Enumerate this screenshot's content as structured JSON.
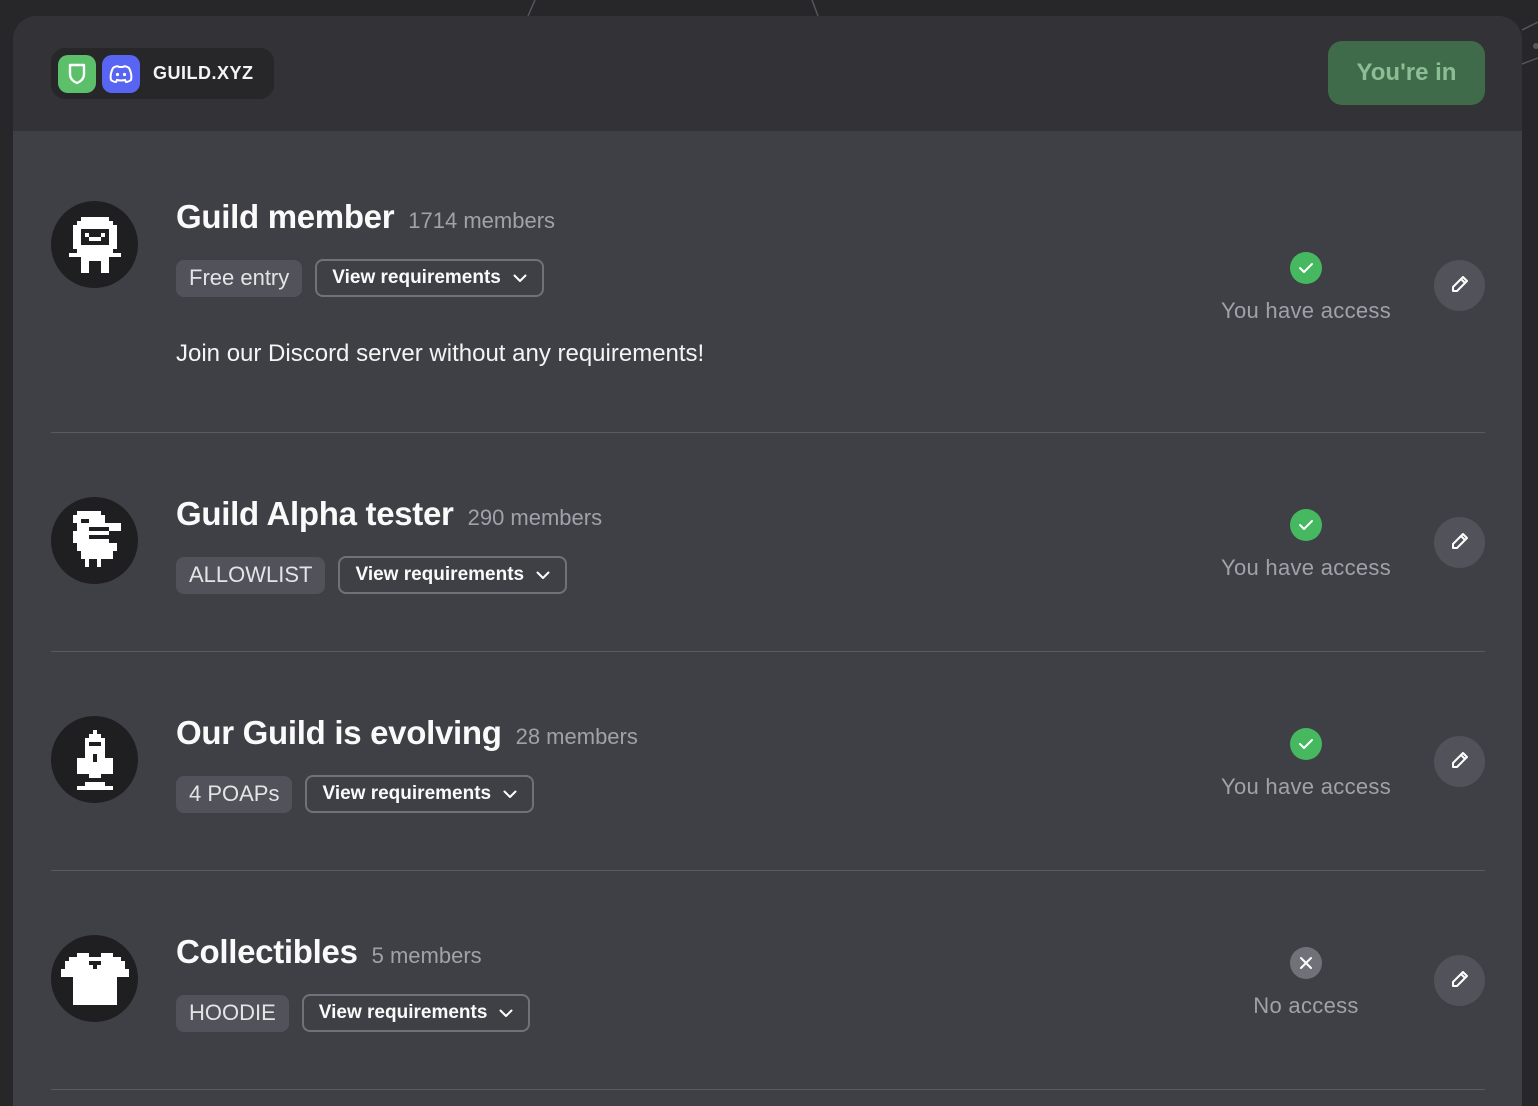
{
  "header": {
    "platform_label": "GUILD.XYZ",
    "joined_label": "You're in",
    "icons": [
      "shield-icon",
      "discord-icon"
    ]
  },
  "colors": {
    "background": "#27272a",
    "card": "#3f3f46",
    "header": "#323237",
    "access_ok": "#46b85f",
    "joined_button": "#3f6b4a"
  },
  "roles": [
    {
      "name": "Guild member",
      "members": "1714 members",
      "tag": "Free entry",
      "requirements_label": "View requirements",
      "description": "Join our Discord server without any requirements!",
      "access_label": "You have access",
      "has_access": true,
      "avatar_icon": "astronaut-icon"
    },
    {
      "name": "Guild Alpha tester",
      "members": "290 members",
      "tag": "ALLOWLIST",
      "requirements_label": "View requirements",
      "description": "",
      "access_label": "You have access",
      "has_access": true,
      "avatar_icon": "bird-icon"
    },
    {
      "name": "Our Guild is evolving",
      "members": "28 members",
      "tag": "4 POAPs",
      "requirements_label": "View requirements",
      "description": "",
      "access_label": "You have access",
      "has_access": true,
      "avatar_icon": "rocket-icon"
    },
    {
      "name": "Collectibles",
      "members": "5 members",
      "tag": "HOODIE",
      "requirements_label": "View requirements",
      "description": "",
      "access_label": "No access",
      "has_access": false,
      "avatar_icon": "tshirt-icon"
    }
  ]
}
